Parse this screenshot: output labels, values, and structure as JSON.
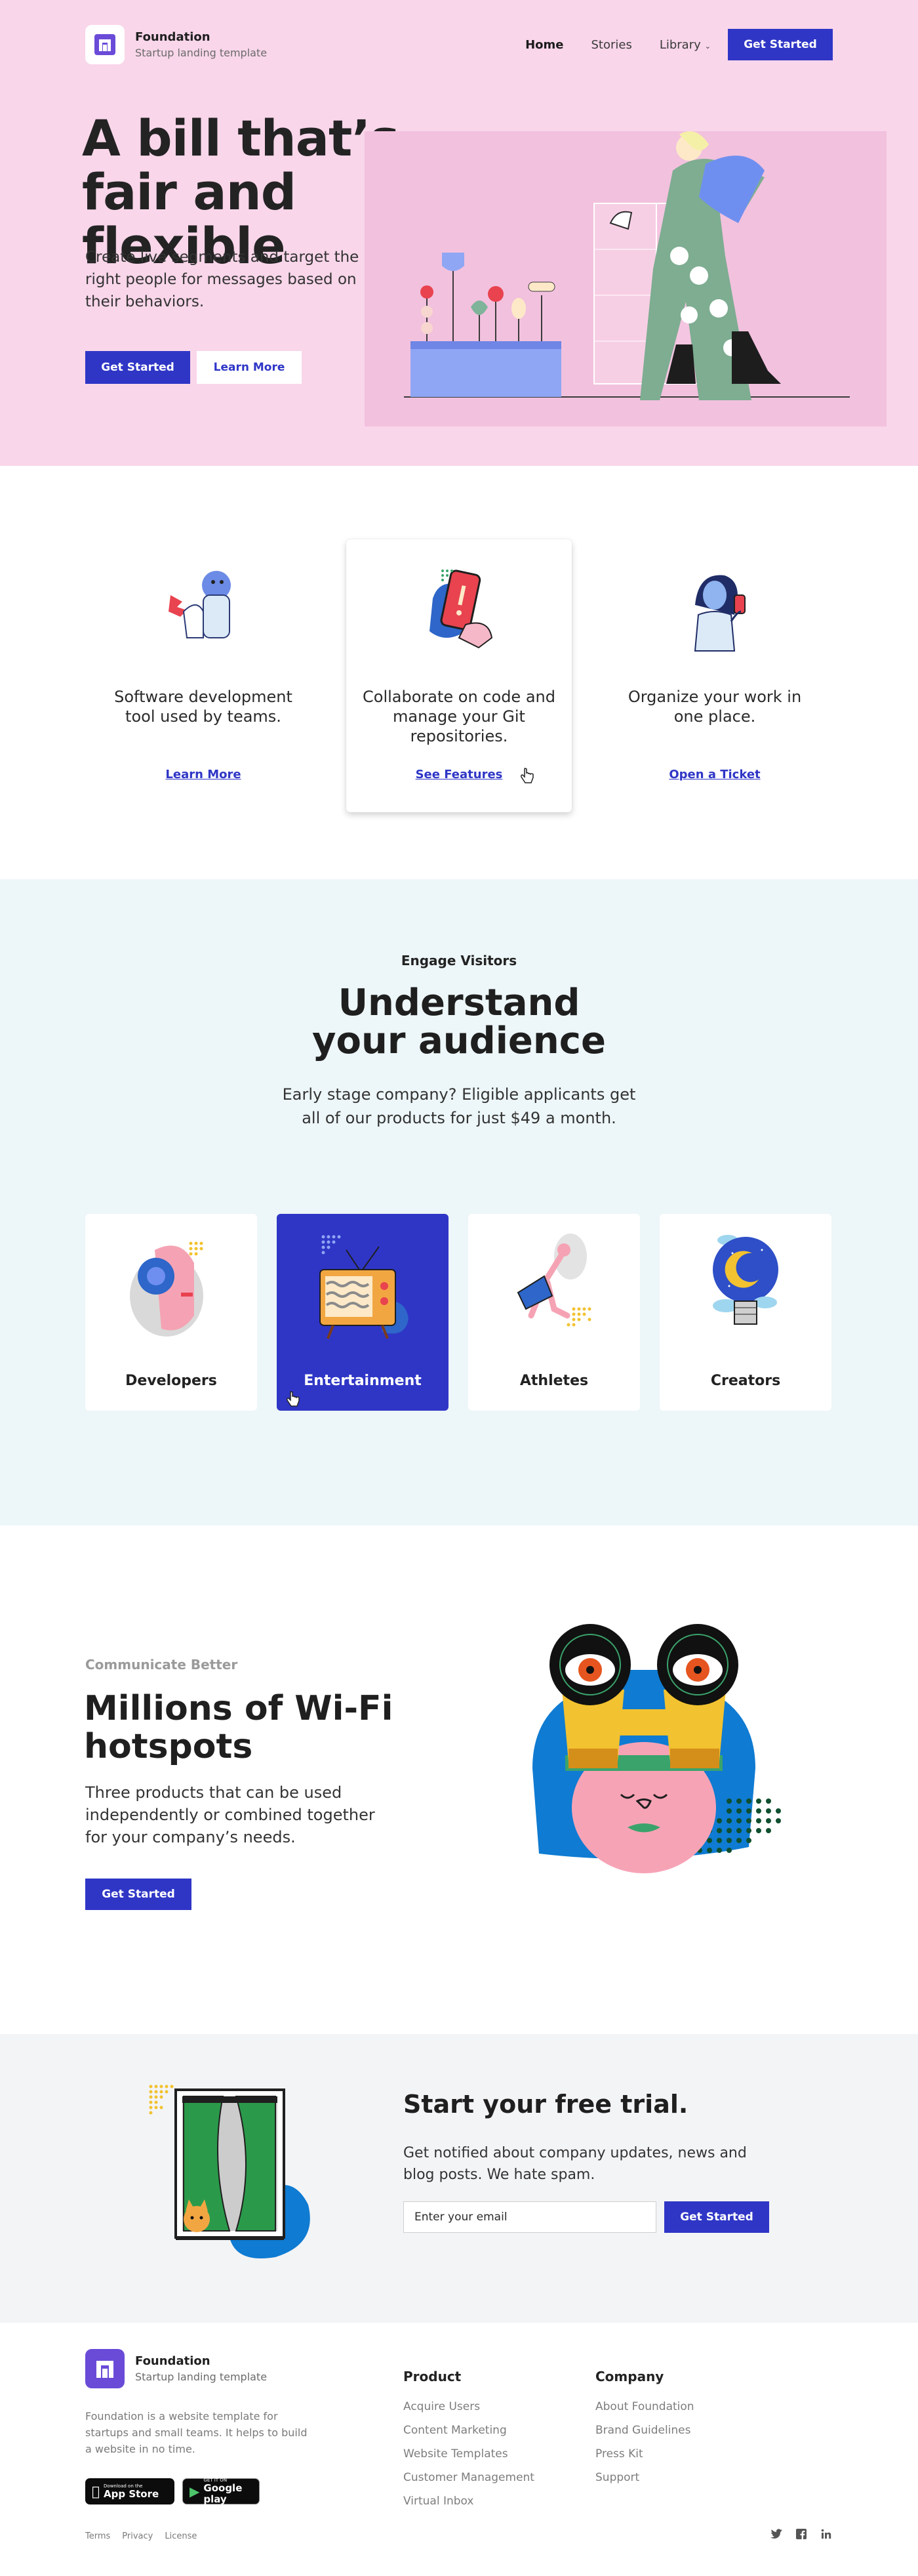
{
  "brand": {
    "name": "Foundation",
    "tagline": "Startup landing template"
  },
  "nav": {
    "links": [
      "Home",
      "Stories",
      "Library"
    ],
    "cta": "Get Started"
  },
  "hero": {
    "title": "A bill that’s fair and flexible",
    "subtitle": "Create live segments and target the right people for messages based on their behaviors.",
    "primary_button": "Get Started",
    "secondary_button": "Learn More"
  },
  "features": [
    {
      "text": "Software development tool used by teams.",
      "link": "Learn More"
    },
    {
      "text": "Collaborate on code and manage your Git repositories.",
      "link": "See Features"
    },
    {
      "text": "Organize your work in one place.",
      "link": "Open a Ticket"
    }
  ],
  "audience": {
    "eyebrow": "Engage Visitors",
    "title": "Understand your audience",
    "subtitle": "Early stage company? Eligible applicants get all of our products for just $49 a month.",
    "tiles": [
      "Developers",
      "Entertainment",
      "Athletes",
      "Creators"
    ]
  },
  "hotspots": {
    "eyebrow": "Communicate Better",
    "title": "Millions of Wi-Fi hotspots",
    "subtitle": "Three products that can be used independently or combined together for your company’s needs.",
    "button": "Get Started"
  },
  "trial": {
    "title": "Start your free trial.",
    "subtitle": "Get notified about company updates, news and blog posts. We hate spam.",
    "email_placeholder": "Enter your email",
    "button": "Get Started"
  },
  "footer": {
    "description": "Foundation is a website template for startups and small teams. It helps to build a website in no time.",
    "app_store": {
      "small": "Download on the",
      "big": "App Store"
    },
    "google_play": {
      "small": "GET IT ON",
      "big": "Google play"
    },
    "columns": [
      {
        "title": "Product",
        "links": [
          "Acquire Users",
          "Content Marketing",
          "Website Templates",
          "Customer Management",
          "Virtual Inbox"
        ]
      },
      {
        "title": "Company",
        "links": [
          "About Foundation",
          "Brand Guidelines",
          "Press Kit",
          "Support"
        ]
      }
    ],
    "legal": [
      "Terms",
      "Privacy",
      "License"
    ],
    "socials": [
      "twitter-icon",
      "facebook-icon",
      "linkedin-icon"
    ]
  },
  "colors": {
    "accent": "#2f36c6",
    "hero_bg": "#f9d6ea",
    "audience_bg": "#edf6f8",
    "trial_bg": "#f3f4f6"
  }
}
